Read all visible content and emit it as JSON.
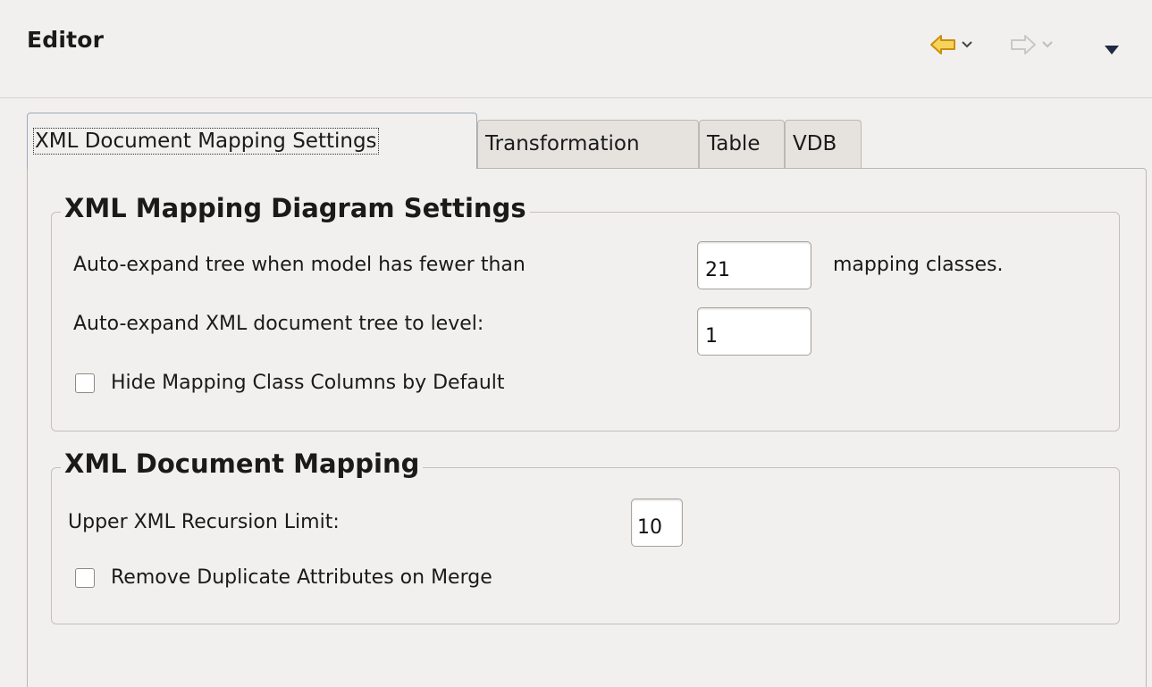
{
  "header": {
    "title": "Editor",
    "nav": {
      "back_icon": "back-arrow-icon",
      "forward_icon": "forward-arrow-icon",
      "menu_icon": "view-menu-icon",
      "back_color": "#f0b820",
      "forward_color": "#c8c8c8"
    }
  },
  "tabs": [
    {
      "label": "XML Document Mapping Settings",
      "active": true
    },
    {
      "label": "Transformation",
      "active": false
    },
    {
      "label": "Table",
      "active": false
    },
    {
      "label": "VDB",
      "active": false
    }
  ],
  "diagram_settings": {
    "title": "XML Mapping Diagram Settings",
    "expand_tree_label": "Auto-expand tree when model has fewer than",
    "expand_tree_value": "21",
    "expand_tree_suffix": "mapping classes.",
    "expand_level_label": "Auto-expand XML document tree to level:",
    "expand_level_value": "1",
    "hide_columns_label": "Hide Mapping Class Columns by Default",
    "hide_columns_checked": false
  },
  "document_mapping": {
    "title": "XML Document Mapping",
    "recursion_label": "Upper XML Recursion Limit:",
    "recursion_value": "10",
    "remove_duplicates_label": "Remove Duplicate Attributes on Merge",
    "remove_duplicates_checked": false
  }
}
